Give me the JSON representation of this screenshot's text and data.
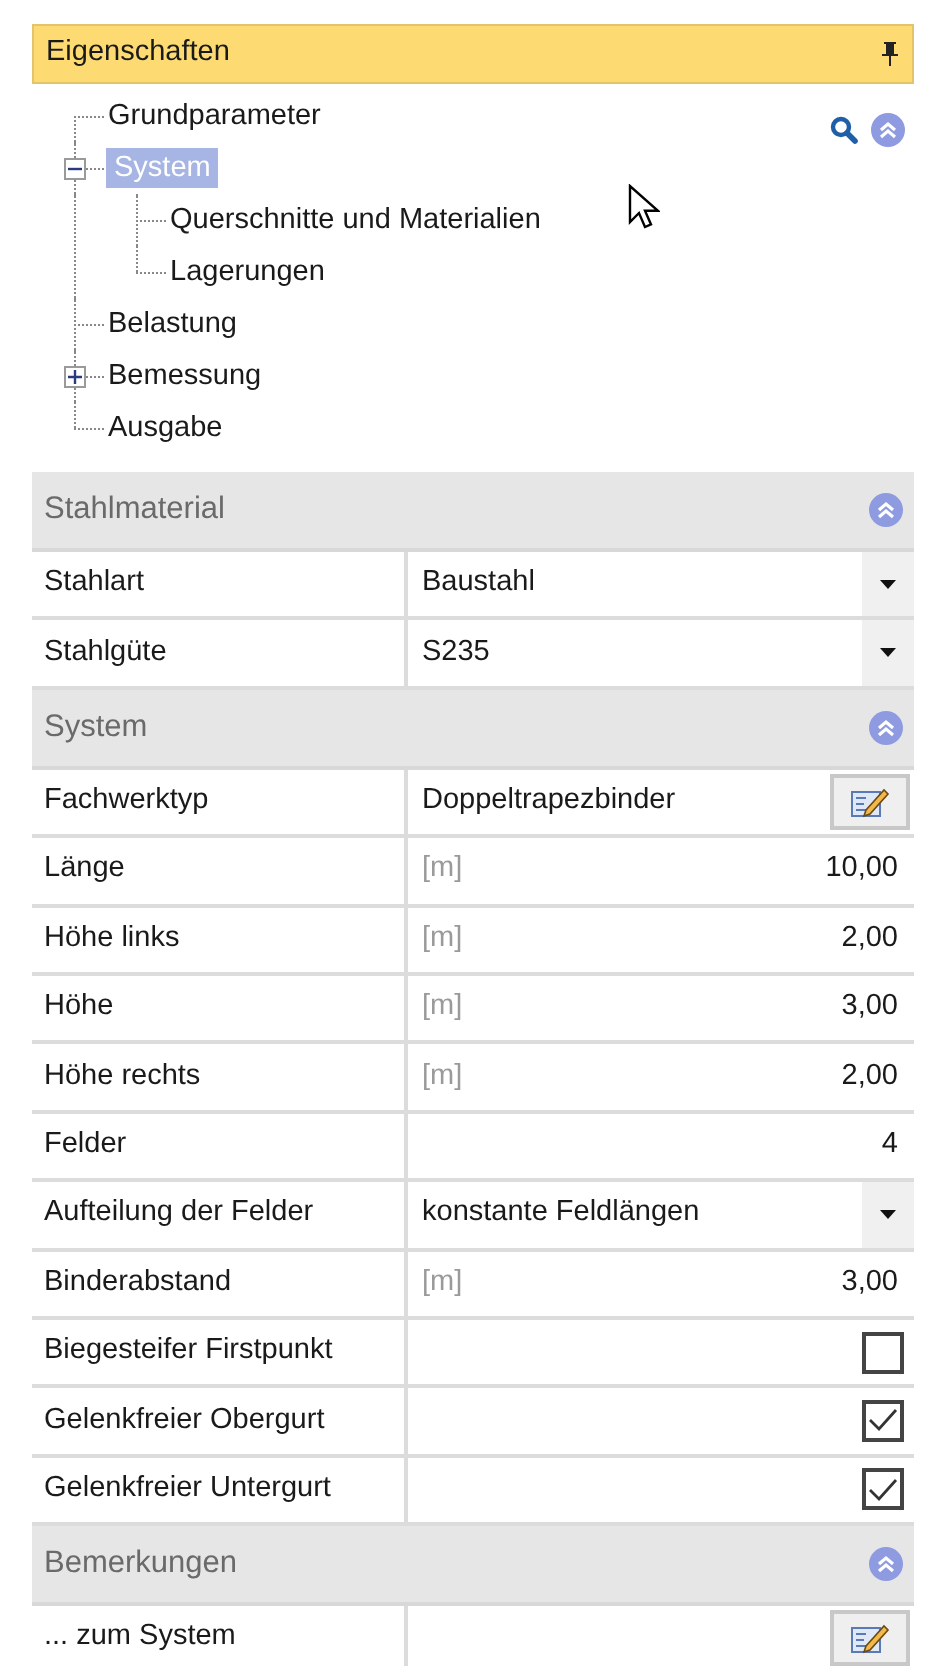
{
  "panel": {
    "title": "Eigenschaften"
  },
  "tree": [
    {
      "label": "Grundparameter",
      "selected": false
    },
    {
      "label": "System",
      "selected": true,
      "expanded": true,
      "children": [
        {
          "label": "Querschnitte und Materialien",
          "selected": false
        },
        {
          "label": "Lagerungen",
          "selected": false
        }
      ]
    },
    {
      "label": "Belastung",
      "selected": false
    },
    {
      "label": "Bemessung",
      "selected": false,
      "expanded": false
    },
    {
      "label": "Ausgabe",
      "selected": false
    }
  ],
  "sections": [
    {
      "title": "Stahlmaterial",
      "rows": [
        {
          "kind": "dropdown",
          "label": "Stahlart",
          "value": "Baustahl"
        },
        {
          "kind": "dropdown",
          "label": "Stahlgüte",
          "value": "S235"
        }
      ]
    },
    {
      "title": "System",
      "rows": [
        {
          "kind": "edit",
          "label": "Fachwerktyp",
          "value": "Doppeltrapezbinder"
        },
        {
          "kind": "number",
          "label": "Länge",
          "unit": "[m]",
          "value": "10,00"
        },
        {
          "kind": "number",
          "label": "Höhe links",
          "unit": "[m]",
          "value": "2,00"
        },
        {
          "kind": "number",
          "label": "Höhe",
          "unit": "[m]",
          "value": "3,00"
        },
        {
          "kind": "number",
          "label": "Höhe rechts",
          "unit": "[m]",
          "value": "2,00"
        },
        {
          "kind": "number",
          "label": "Felder",
          "value": "4"
        },
        {
          "kind": "dropdown",
          "label": "Aufteilung der Felder",
          "value": "konstante Feldlängen"
        },
        {
          "kind": "number",
          "label": "Binderabstand",
          "unit": "[m]",
          "value": "3,00"
        },
        {
          "kind": "checkbox",
          "label": "Biegesteifer Firstpunkt",
          "checked": false
        },
        {
          "kind": "checkbox",
          "label": "Gelenkfreier Obergurt",
          "checked": true
        },
        {
          "kind": "checkbox",
          "label": "Gelenkfreier Untergurt",
          "checked": true
        }
      ]
    },
    {
      "title": "Bemerkungen",
      "rows": [
        {
          "kind": "edit",
          "label": "... zum System"
        }
      ]
    }
  ]
}
